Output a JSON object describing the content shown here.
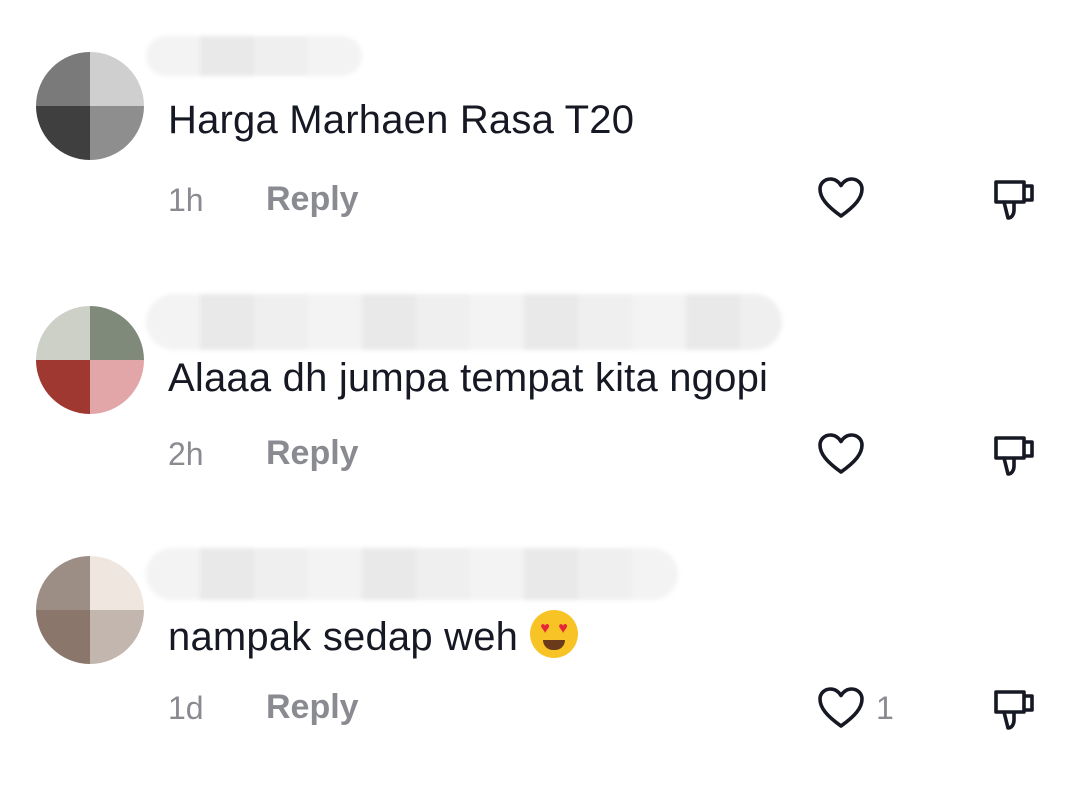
{
  "comments": [
    {
      "text": "Harga Marhaen Rasa T20",
      "time": "1h",
      "reply_label": "Reply",
      "like_count": "",
      "avatar_colors": [
        "#7a7a7a",
        "#cfcfcf",
        "#3f3f3f",
        "#8e8e8e"
      ]
    },
    {
      "text": "Alaaa dh jumpa tempat kita ngopi",
      "time": "2h",
      "reply_label": "Reply",
      "like_count": "",
      "avatar_colors": [
        "#cdd0c6",
        "#7f8a7b",
        "#a03832",
        "#e2a6a8"
      ]
    },
    {
      "text": "nampak sedap weh",
      "time": "1d",
      "reply_label": "Reply",
      "like_count": "1",
      "emoji": "heart-eyes-emoji",
      "avatar_colors": [
        "#9c8e84",
        "#efe7df",
        "#8a766b",
        "#c2b6ae"
      ]
    }
  ],
  "icons": {
    "like": "heart-outline-icon",
    "dislike": "thumbs-down-icon"
  },
  "colors": {
    "primary_text": "#161823",
    "secondary_text": "#8a8b91",
    "icon": "#161823",
    "background": "#ffffff"
  }
}
